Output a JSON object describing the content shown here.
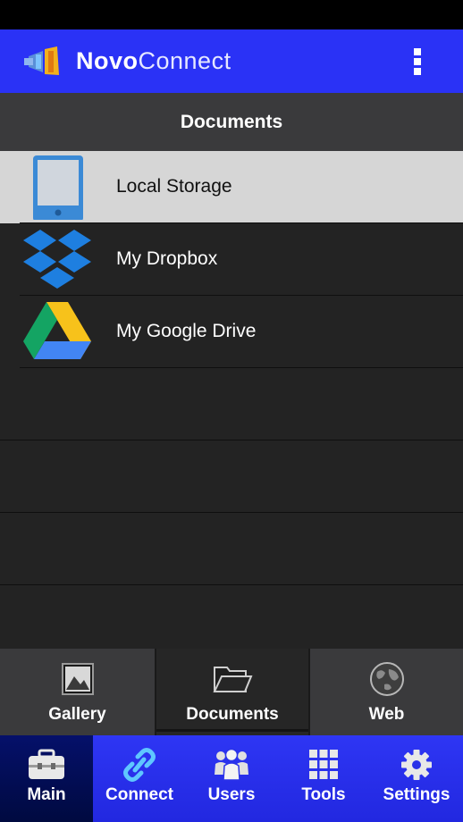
{
  "app": {
    "title_bold": "Novo",
    "title_rest": "Connect"
  },
  "header": {
    "title": "Documents"
  },
  "list": [
    {
      "label": "Local Storage",
      "icon": "tablet-icon",
      "selected": true
    },
    {
      "label": "My Dropbox",
      "icon": "dropbox-icon",
      "selected": false
    },
    {
      "label": "My Google Drive",
      "icon": "google-drive-icon",
      "selected": false
    }
  ],
  "sub_tabs": [
    {
      "label": "Gallery",
      "icon": "gallery-icon",
      "active": false
    },
    {
      "label": "Documents",
      "icon": "folder-open-icon",
      "active": true
    },
    {
      "label": "Web",
      "icon": "globe-icon",
      "active": false
    }
  ],
  "bottom_nav": [
    {
      "label": "Main",
      "icon": "toolbox-icon",
      "active": true
    },
    {
      "label": "Connect",
      "icon": "link-icon",
      "active": false
    },
    {
      "label": "Users",
      "icon": "users-icon",
      "active": false
    },
    {
      "label": "Tools",
      "icon": "grid-icon",
      "active": false
    },
    {
      "label": "Settings",
      "icon": "gear-icon",
      "active": false
    }
  ],
  "colors": {
    "app_bar": "#2a32f6",
    "header_bg": "#3a3a3c",
    "list_bg": "#232323",
    "selected_row": "#d6d6d6",
    "nav_active": "#05106a",
    "connect_accent": "#5fc6ff"
  }
}
